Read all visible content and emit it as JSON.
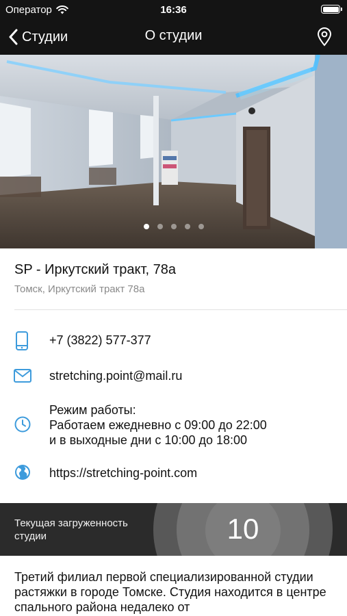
{
  "status_bar": {
    "carrier": "Оператор",
    "time": "16:36",
    "icons": [
      "wifi-icon",
      "battery-icon"
    ]
  },
  "nav": {
    "back_label": "Студии",
    "title": "О студии",
    "icons": [
      "chevron-left-icon",
      "map-pin-icon"
    ]
  },
  "gallery": {
    "page_count": 5,
    "current_page": 1
  },
  "studio": {
    "name": "SP - Иркутский тракт, 78а",
    "address": "Томск, Иркутский тракт 78а"
  },
  "contacts": {
    "phone": "+7 (3822) 577-377",
    "email": "stretching.point@mail.ru",
    "hours_title": "Режим работы:",
    "hours_line1": "Работаем ежедневно с 09:00 до 22:00",
    "hours_line2": "и в выходные дни с 10:00 до 18:00",
    "website": "https://stretching-point.com",
    "icons": [
      "phone-icon",
      "mail-icon",
      "clock-icon",
      "globe-icon"
    ]
  },
  "workload": {
    "label": "Текущая загруженность студии",
    "value": "10"
  },
  "description": "Третий филиал первой специализированной студии растяжки в городе Томске. Студия находится в центре спального района недалеко от",
  "colors": {
    "accent": "#3d9bdc",
    "header_bg": "#141414",
    "workload_bg": "#2b2b2b"
  }
}
